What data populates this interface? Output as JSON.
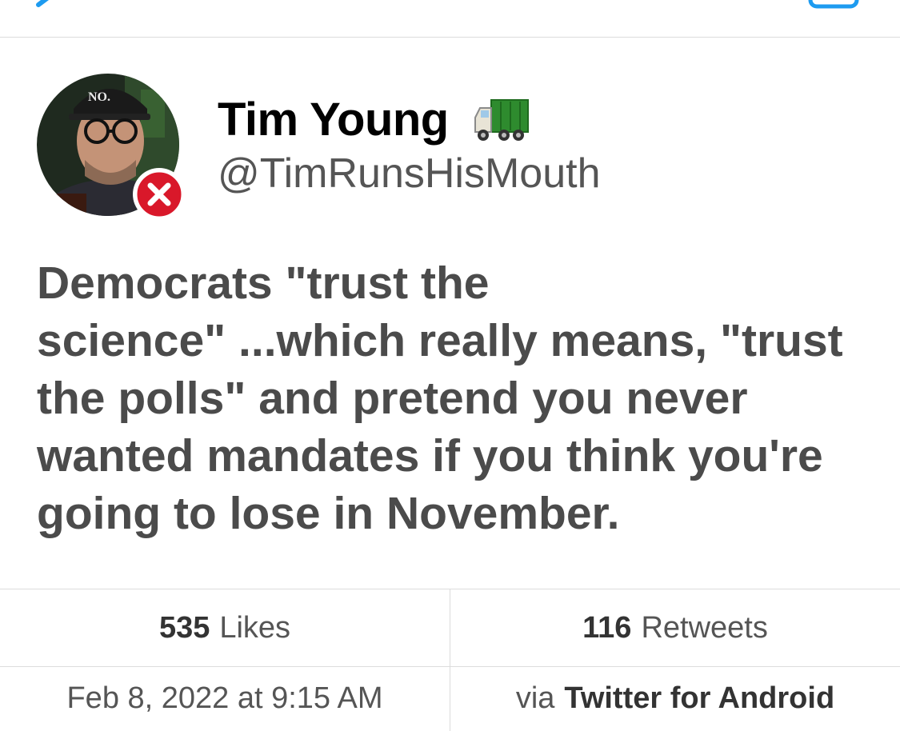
{
  "header": {
    "back_icon": "chevron-left-icon",
    "right_icon": "compose-icon"
  },
  "tweet": {
    "display_name": "Tim Young",
    "name_emoji": "truck-icon",
    "handle": "@TimRunsHisMouth",
    "avatar_hat_text": "NO.",
    "badge_icon": "red-x-icon",
    "text": "Democrats \"trust the\nscience\" ...which really means, \"trust\nthe polls\" and pretend you never\nwanted mandates if you think you're\ngoing to lose in November."
  },
  "stats": {
    "likes_count": "535",
    "likes_label": "Likes",
    "retweets_count": "116",
    "retweets_label": "Retweets"
  },
  "meta": {
    "timestamp": "Feb 8, 2022 at 9:15 AM",
    "via_label": "via",
    "client": "Twitter for Android"
  },
  "colors": {
    "accent": "#1d9bf0",
    "badge_red": "#d9182a",
    "text": "#4b4b4b",
    "divider": "#dcdcdc"
  }
}
